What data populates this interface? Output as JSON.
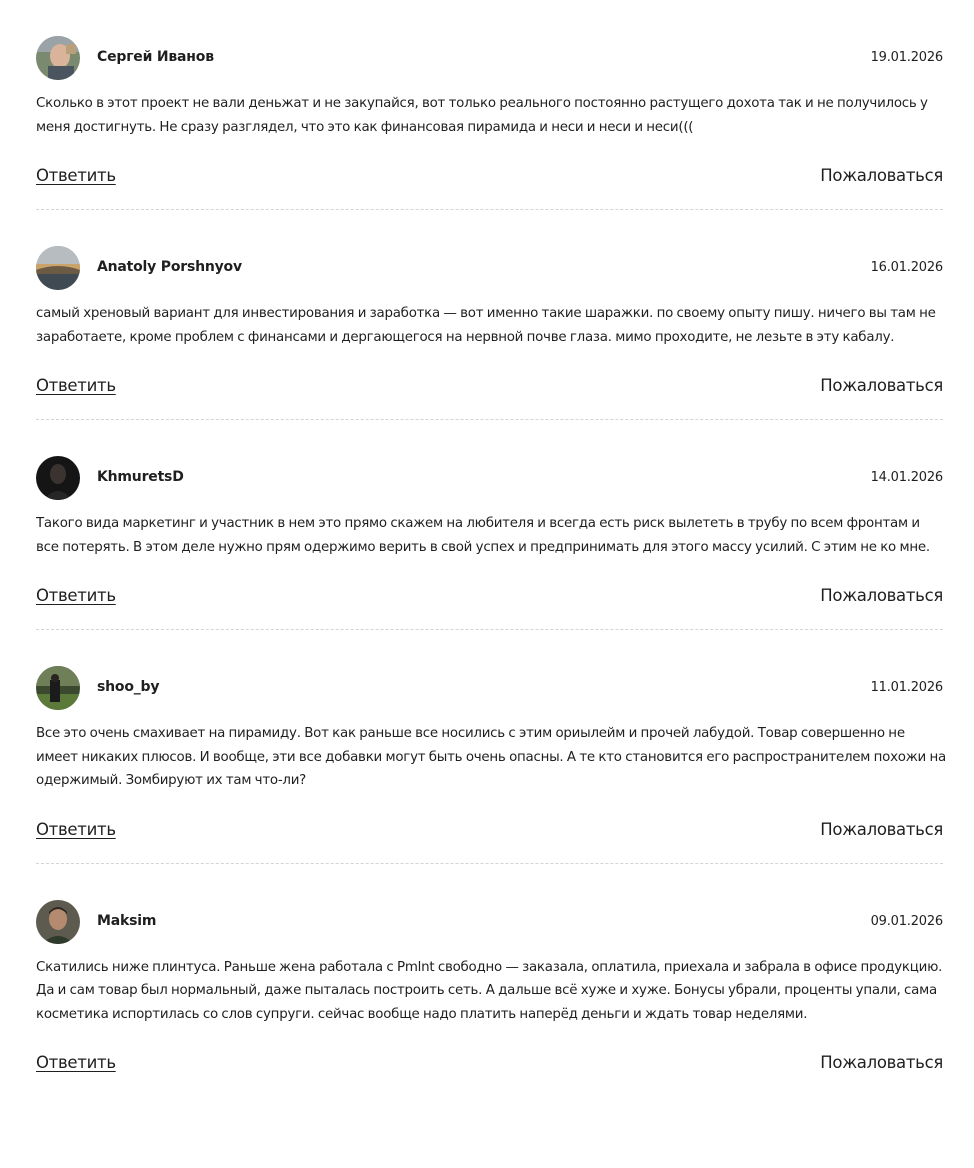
{
  "comments": [
    {
      "author": "Сергей Иванов",
      "date": "19.01.2026",
      "text": "Сколько в этот проект не вали деньжат и не закупайся, вот только реального постоянно растущего дохота так и не получилось у меня достигнуть. Не сразу разглядел, что это как финансовая пирамида и неси и неси и неси(((",
      "reply_label": "Ответить",
      "report_label": "Пожаловаться"
    },
    {
      "author": "Anatoly Porshnyov",
      "date": "16.01.2026",
      "text": "самый хреновый вариант для инвестирования и заработка — вот именно такие шаражки. по своему опыту пишу. ничего вы там не заработаете, кроме проблем с финансами и дергающегося на нервной почве глаза. мимо проходите, не лезьте в эту кабалу.",
      "reply_label": "Ответить",
      "report_label": "Пожаловаться"
    },
    {
      "author": "KhmuretsD",
      "date": "14.01.2026",
      "text": "Такого вида маркетинг и участник в нем это прямо скажем на любителя и всегда есть риск вылететь в трубу по всем фронтам и все потерять. В этом деле нужно прям одержимо верить в свой успех и предпринимать для этого массу усилий. С этим не ко мне.",
      "reply_label": "Ответить",
      "report_label": "Пожаловаться"
    },
    {
      "author": "shoo_by",
      "date": "11.01.2026",
      "text": "Все это очень смахивает на пирамиду. Вот как раньше все носились с этим ориылейм и прочей лабудой. Товар совершенно не имеет никаких плюсов. И вообще, эти все добавки могут быть очень опасны. А те кто становится его распространителем похожи на одержимый. Зомбируют их там что-ли?",
      "reply_label": "Ответить",
      "report_label": "Пожаловаться"
    },
    {
      "author": "Maksim",
      "date": "09.01.2026",
      "text": "Скатились ниже плинтуса. Раньше жена работала с Pmlnt свободно — заказала, оплатила, приехала и забрала в офисе продукцию. Да и сам товар был нормальный, даже пыталась построить сеть. А дальше всё хуже и хуже. Бонусы убрали, проценты упали, сама косметика испортилась со слов супруги. сейчас вообще надо платить наперёд деньги и ждать товар неделями.",
      "reply_label": "Ответить",
      "report_label": "Пожаловаться"
    }
  ]
}
